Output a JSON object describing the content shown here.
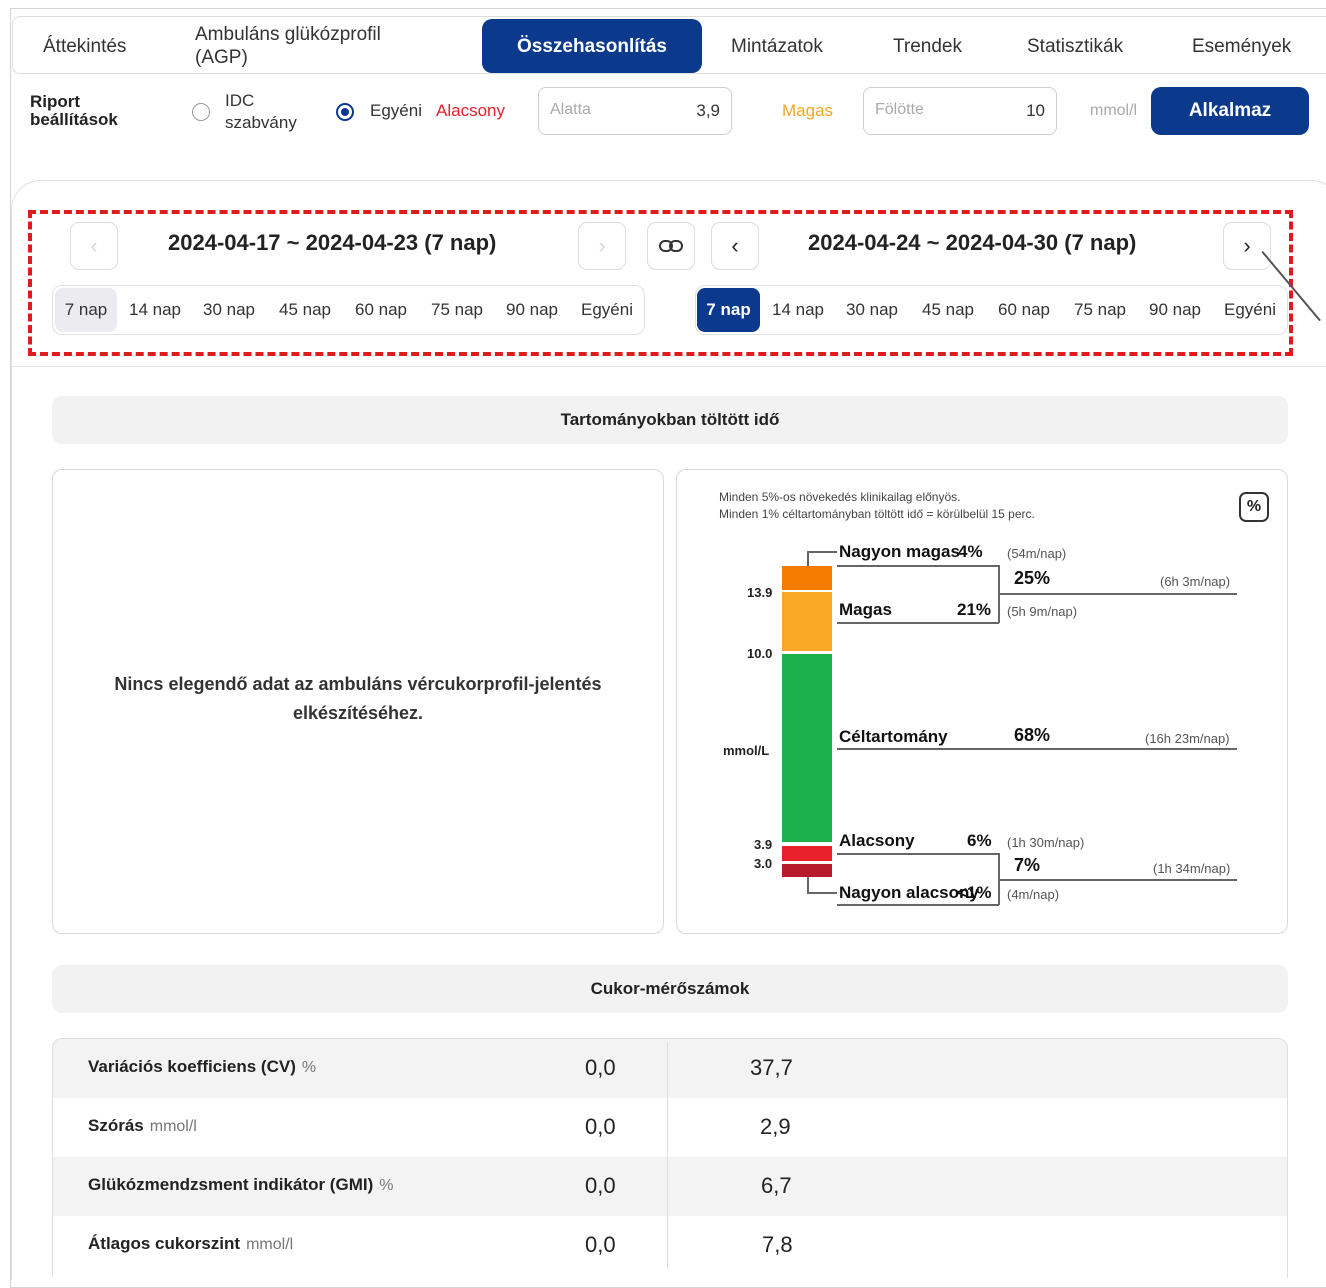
{
  "tabs": [
    {
      "label": "Áttekintés"
    },
    {
      "label": "Ambuláns glükózprofil (AGP)"
    },
    {
      "label": "Összehasonlítás"
    },
    {
      "label": "Mintázatok"
    },
    {
      "label": "Trendek"
    },
    {
      "label": "Statisztikák"
    },
    {
      "label": "Események"
    }
  ],
  "settings": {
    "title": "Riport beállítások",
    "idc_label": "IDC szabvány",
    "custom_label": "Egyéni",
    "selected": "Egyéni",
    "low_label": "Alacsony",
    "low_placeholder": "Alatta",
    "low_value": "3,9",
    "high_label": "Magas",
    "high_placeholder": "Fölötte",
    "high_value": "10",
    "unit": "mmol/l",
    "apply_label": "Alkalmaz",
    "colors": {
      "low": "#e8202a",
      "high": "#f5a623",
      "accent": "#0b3a8c"
    }
  },
  "comparison": {
    "left": {
      "range": "2024-04-17 ~ 2024-04-23 (7 nap)",
      "prev_icon": "chevron-left-icon",
      "next_icon": "chevron-right-icon",
      "periods": [
        "7 nap",
        "14 nap",
        "30 nap",
        "45 nap",
        "60 nap",
        "75 nap",
        "90 nap",
        "Egyéni"
      ],
      "selected": "7 nap"
    },
    "link_icon": "link-icon",
    "right": {
      "range": "2024-04-24 ~ 2024-04-30 (7 nap)",
      "prev_icon": "chevron-left-icon",
      "next_icon": "chevron-right-icon",
      "periods": [
        "7 nap",
        "14 nap",
        "30 nap",
        "45 nap",
        "60 nap",
        "75 nap",
        "90 nap",
        "Egyéni"
      ],
      "selected": "7 nap"
    }
  },
  "tir": {
    "section_title": "Tartományokban töltött idő",
    "no_data_line1": "Nincs elegendő adat az ambuláns vércukorprofil-jelentés",
    "no_data_line2": "elkészítéséhez.",
    "note1": "Minden 5%-os növekedés klinikailag előnyös.",
    "note2": "Minden 1% céltartományban töltött idő = körülbelül 15 perc.",
    "percent_icon": "percent-icon",
    "axis_unit": "mmol/L",
    "ticks": [
      "13.9",
      "10.0",
      "3.9",
      "3.0"
    ],
    "colors": {
      "very_high": "#f57c00",
      "high": "#f9a825",
      "target": "#1cb14a",
      "low": "#e8202a",
      "very_low": "#b71c2c"
    },
    "very_high": {
      "label": "Nagyon magas",
      "pct": "4%",
      "time": "(54m/nap)"
    },
    "high": {
      "label": "Magas",
      "pct": "21%",
      "time": "(5h 9m/nap)"
    },
    "high_total": {
      "pct": "25%",
      "time": "(6h 3m/nap)"
    },
    "target": {
      "label": "Céltartomány",
      "pct": "68%",
      "time": "(16h 23m/nap)"
    },
    "low": {
      "label": "Alacsony",
      "pct": "6%",
      "time": "(1h 30m/nap)"
    },
    "low_total": {
      "pct": "7%",
      "time": "(1h 34m/nap)"
    },
    "very_low": {
      "label": "Nagyon alacsony",
      "pct": "<1%",
      "time": "(4m/nap)"
    }
  },
  "metrics": {
    "section_title": "Cukor-mérőszámok",
    "rows": [
      {
        "name": "Variációs koefficiens (CV)",
        "unit": "%",
        "v1": "0,0",
        "v2": "37,7"
      },
      {
        "name": "Szórás",
        "unit": "mmol/l",
        "v1": "0,0",
        "v2": "2,9"
      },
      {
        "name": "Glükózmendzsment indikátor (GMI)",
        "unit": "%",
        "v1": "0,0",
        "v2": "6,7"
      },
      {
        "name": "Átlagos cukorszint",
        "unit": "mmol/l",
        "v1": "0,0",
        "v2": "7,8"
      }
    ]
  }
}
